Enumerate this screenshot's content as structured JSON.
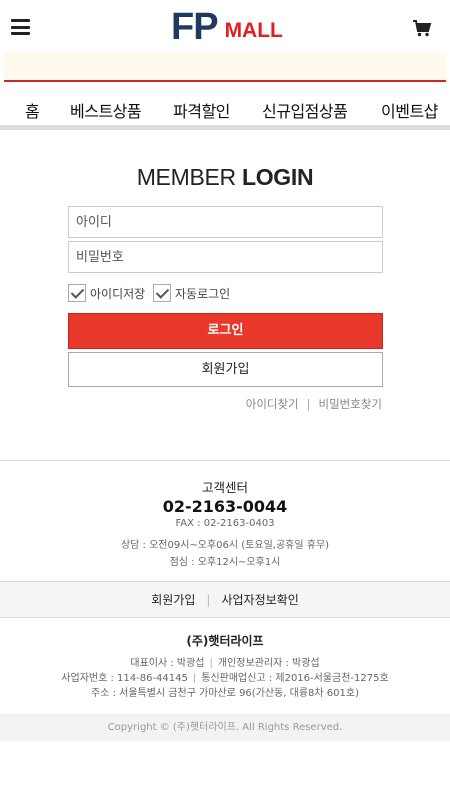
{
  "header": {
    "logo_fp": "FP",
    "logo_mall": "MALL",
    "menu_icon": "hamburger-menu-icon",
    "cart_icon": "shopping-cart-icon"
  },
  "nav": {
    "items": [
      "홈",
      "베스트상품",
      "파격할인",
      "신규입점상품",
      "이벤트샵"
    ]
  },
  "login": {
    "title_light": "MEMBER",
    "title_bold": "LOGIN",
    "id_placeholder": "아이디",
    "pw_placeholder": "비밀번호",
    "save_id_label": "아이디저장",
    "auto_login_label": "자동로그인",
    "login_button": "로그인",
    "join_button": "회원가입",
    "find_id": "아이디찾기",
    "find_pw": "비밀번호찾기",
    "separator": "|"
  },
  "customer_center": {
    "title": "고객센터",
    "phone": "02-2163-0044",
    "fax": "FAX : 02-2163-0403",
    "hours": "상담 : 오전09시~오후06시 (토요일,공휴일 휴무)",
    "lunch": "점심 : 오후12시~오후1시"
  },
  "footer_links": {
    "join": "회원가입",
    "business_info": "사업자정보확인",
    "separator": "|"
  },
  "company": {
    "name": "(주)햇터라이프",
    "ceo": "대표이사 : 박광섭",
    "privacy_officer": "개인정보관리자 : 박광섭",
    "business_no": "사업자번호 : 114-86-44145",
    "ecommerce_no": "통신판매업신고 : 제2016-서울금천-1275호",
    "address": "주소 : 서울특별시 금천구 가마산로 96(가산동, 대륭8차 601호)",
    "separator": "|"
  },
  "copyright": "Copyright © (주)햇터라이프. All Rights Reserved.",
  "colors": {
    "logo_blue": "#1e3a5f",
    "logo_red": "#e02020",
    "login_button": "#e8382c",
    "notice_bg": "#fffaed",
    "notice_border": "#c92a22"
  }
}
